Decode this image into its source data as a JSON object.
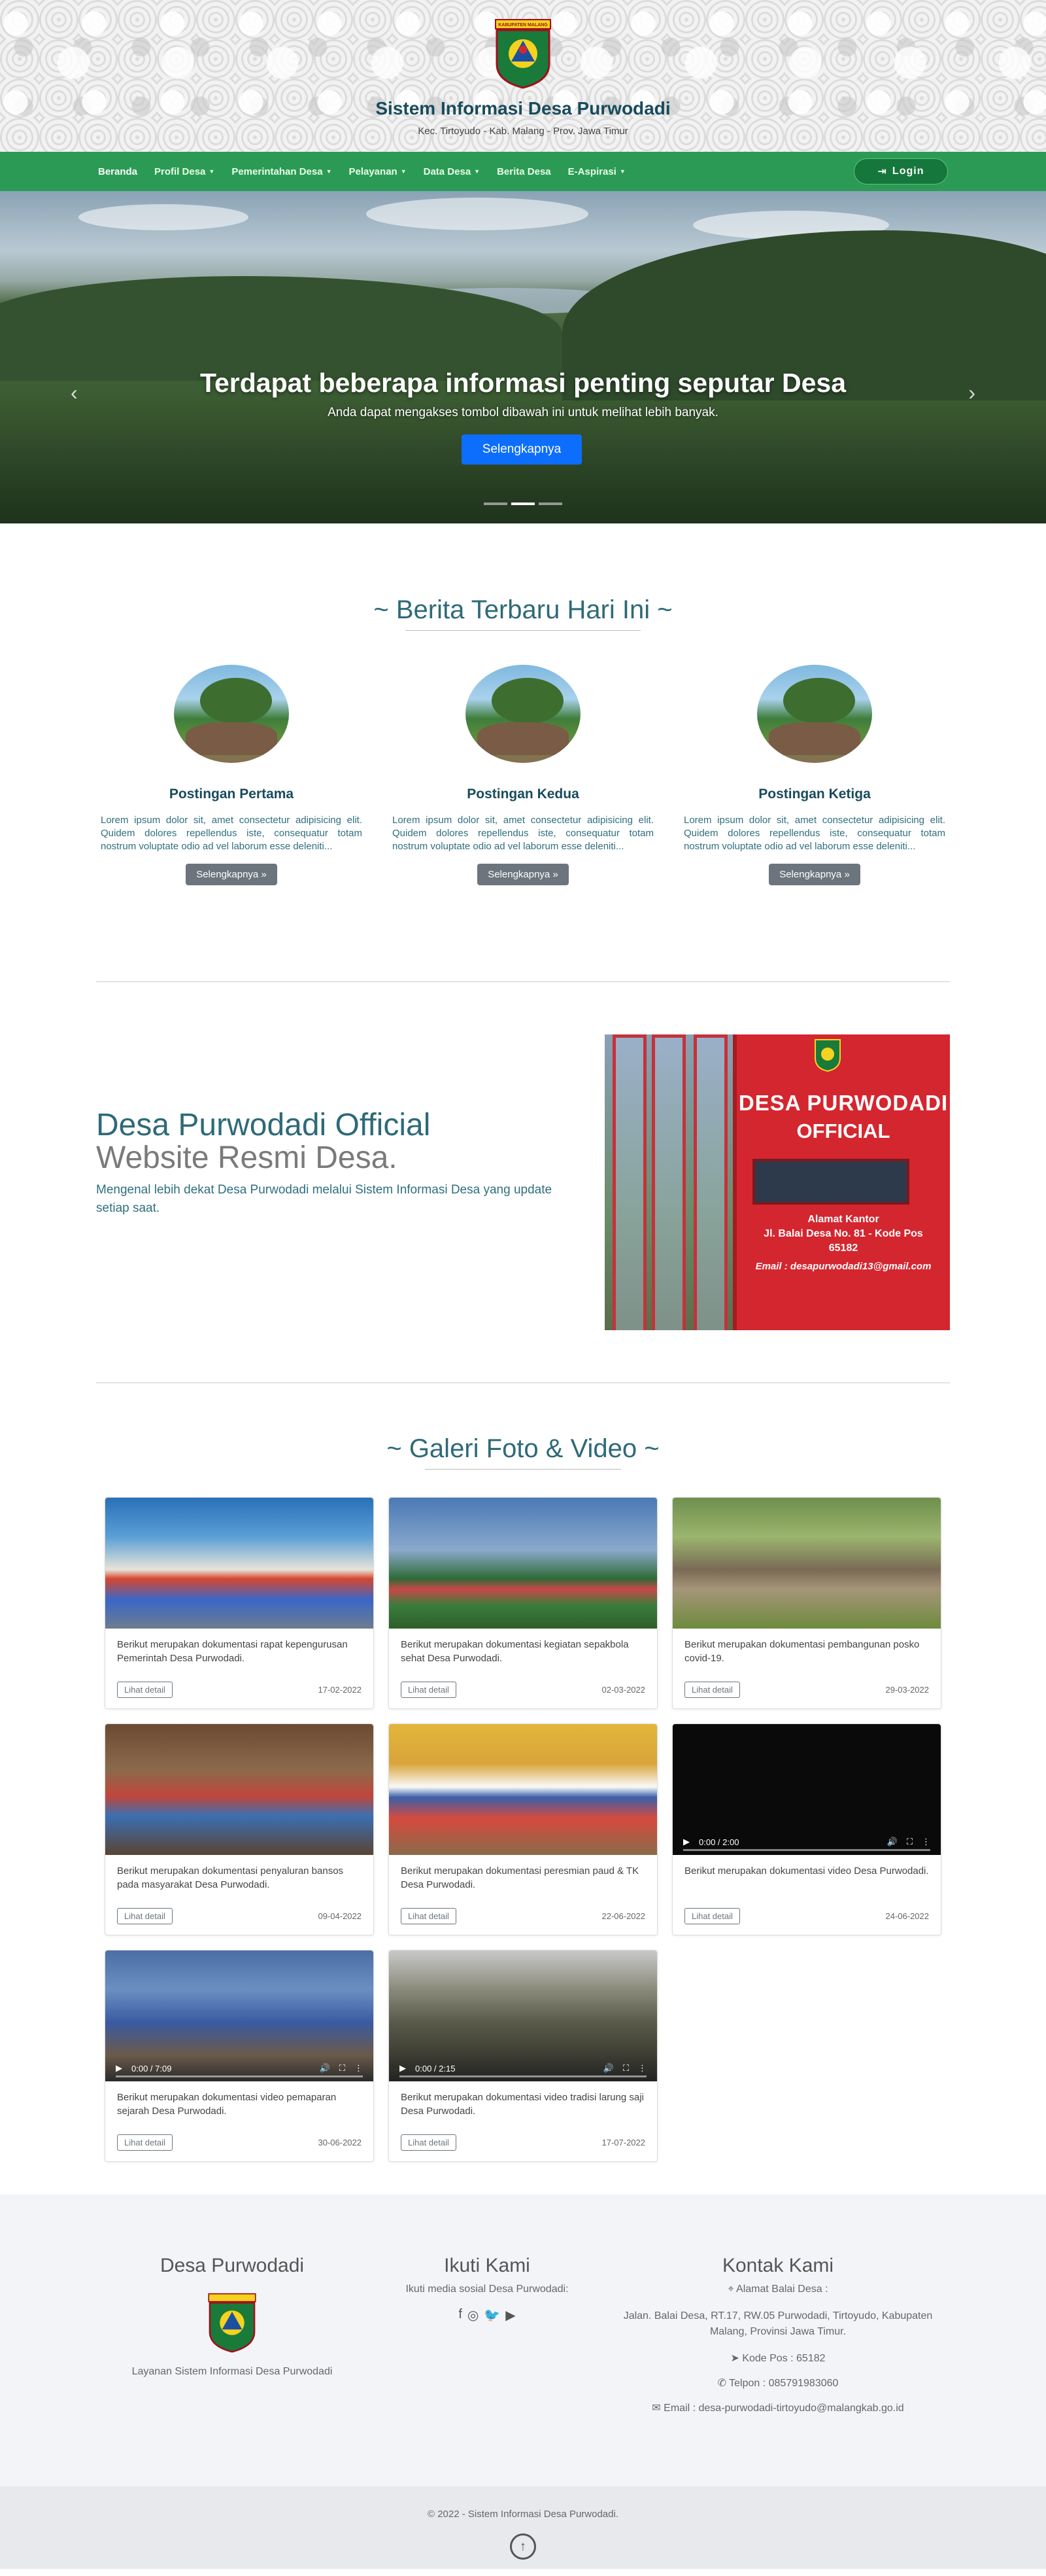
{
  "header": {
    "logo_text": "KABUPATEN MALANG",
    "title": "Sistem Informasi Desa Purwodadi",
    "subtitle": "Kec. Tirtoyudo - Kab. Malang - Prov. Jawa Timur"
  },
  "nav": {
    "items": [
      {
        "label": "Beranda",
        "dropdown": false
      },
      {
        "label": "Profil Desa",
        "dropdown": true
      },
      {
        "label": "Pemerintahan Desa",
        "dropdown": true
      },
      {
        "label": "Pelayanan",
        "dropdown": true
      },
      {
        "label": "Data Desa",
        "dropdown": true
      },
      {
        "label": "Berita Desa",
        "dropdown": false
      },
      {
        "label": "E-Aspirasi",
        "dropdown": true
      }
    ],
    "login_label": "Login"
  },
  "hero": {
    "title": "Terdapat beberapa informasi penting seputar Desa",
    "subtitle": "Anda dapat mengakses tombol dibawah ini untuk melihat lebih banyak.",
    "button_label": "Selengkapnya"
  },
  "news": {
    "heading": "~ Berita Terbaru Hari Ini ~",
    "items": [
      {
        "title": "Postingan Pertama",
        "text": "Lorem ipsum dolor sit, amet consectetur adipisicing elit. Quidem dolores repellendus iste, consequatur totam nostrum voluptate odio ad vel laborum esse deleniti...",
        "button": "Selengkapnya »"
      },
      {
        "title": "Postingan Kedua",
        "text": "Lorem ipsum dolor sit, amet consectetur adipisicing elit. Quidem dolores repellendus iste, consequatur totam nostrum voluptate odio ad vel laborum esse deleniti...",
        "button": "Selengkapnya »"
      },
      {
        "title": "Postingan Ketiga",
        "text": "Lorem ipsum dolor sit, amet consectetur adipisicing elit. Quidem dolores repellendus iste, consequatur totam nostrum voluptate odio ad vel laborum esse deleniti...",
        "button": "Selengkapnya »"
      }
    ]
  },
  "official": {
    "title": "Desa Purwodadi Official",
    "subtitle": "Website Resmi Desa.",
    "text": "Mengenal lebih dekat Desa Purwodadi melalui Sistem Informasi Desa yang update setiap saat.",
    "board_title_1": "DESA PURWODADI",
    "board_title_2": "OFFICIAL",
    "board_address": "Alamat Kantor\nJl. Balai Desa No. 81 - Kode Pos\n65182",
    "board_email": "Email : desapurwodadi13@gmail.com"
  },
  "gallery": {
    "heading": "~ Galeri Foto & Video ~",
    "detail_label": "Lihat detail",
    "items": [
      {
        "type": "photo",
        "caption": "Berikut merupakan dokumentasi rapat kepengurusan Pemerintah Desa Purwodadi.",
        "date": "17-02-2022"
      },
      {
        "type": "photo",
        "caption": "Berikut merupakan dokumentasi kegiatan sepakbola sehat Desa Purwodadi.",
        "date": "02-03-2022"
      },
      {
        "type": "photo",
        "caption": "Berikut merupakan dokumentasi pembangunan posko covid-19.",
        "date": "29-03-2022"
      },
      {
        "type": "photo",
        "caption": "Berikut merupakan dokumentasi penyaluran bansos pada masyarakat Desa Purwodadi.",
        "date": "09-04-2022"
      },
      {
        "type": "photo",
        "caption": "Berikut merupakan dokumentasi peresmian paud & TK Desa Purwodadi.",
        "date": "22-06-2022"
      },
      {
        "type": "video",
        "caption": "Berikut merupakan dokumentasi video Desa Purwodadi.",
        "date": "24-06-2022",
        "time": "0:00 / 2:00"
      },
      {
        "type": "video",
        "caption": "Berikut merupakan dokumentasi video pemaparan sejarah Desa Purwodadi.",
        "date": "30-06-2022",
        "time": "0:00 / 7:09"
      },
      {
        "type": "video",
        "caption": "Berikut merupakan dokumentasi video tradisi larung saji Desa Purwodadi.",
        "date": "17-07-2022",
        "time": "0:00 / 2:15"
      }
    ]
  },
  "footer": {
    "col1_title": "Desa Purwodadi",
    "col1_text": "Layanan Sistem Informasi Desa Purwodadi",
    "col2_title": "Ikuti Kami",
    "col2_text": "Ikuti media sosial Desa Purwodadi:",
    "col3_title": "Kontak Kami",
    "address_label": "Alamat Balai Desa :",
    "address": "Jalan. Balai Desa, RT.17, RW.05 Purwodadi, Tirtoyudo, Kabupaten Malang, Provinsi Jawa Timur.",
    "postal": "Kode Pos : 65182",
    "phone": "Telpon : 085791983060",
    "email": "Email : desa-purwodadi-tirtoyudo@malangkab.go.id",
    "copyright": "© 2022 - Sistem Informasi Desa Purwodadi."
  }
}
